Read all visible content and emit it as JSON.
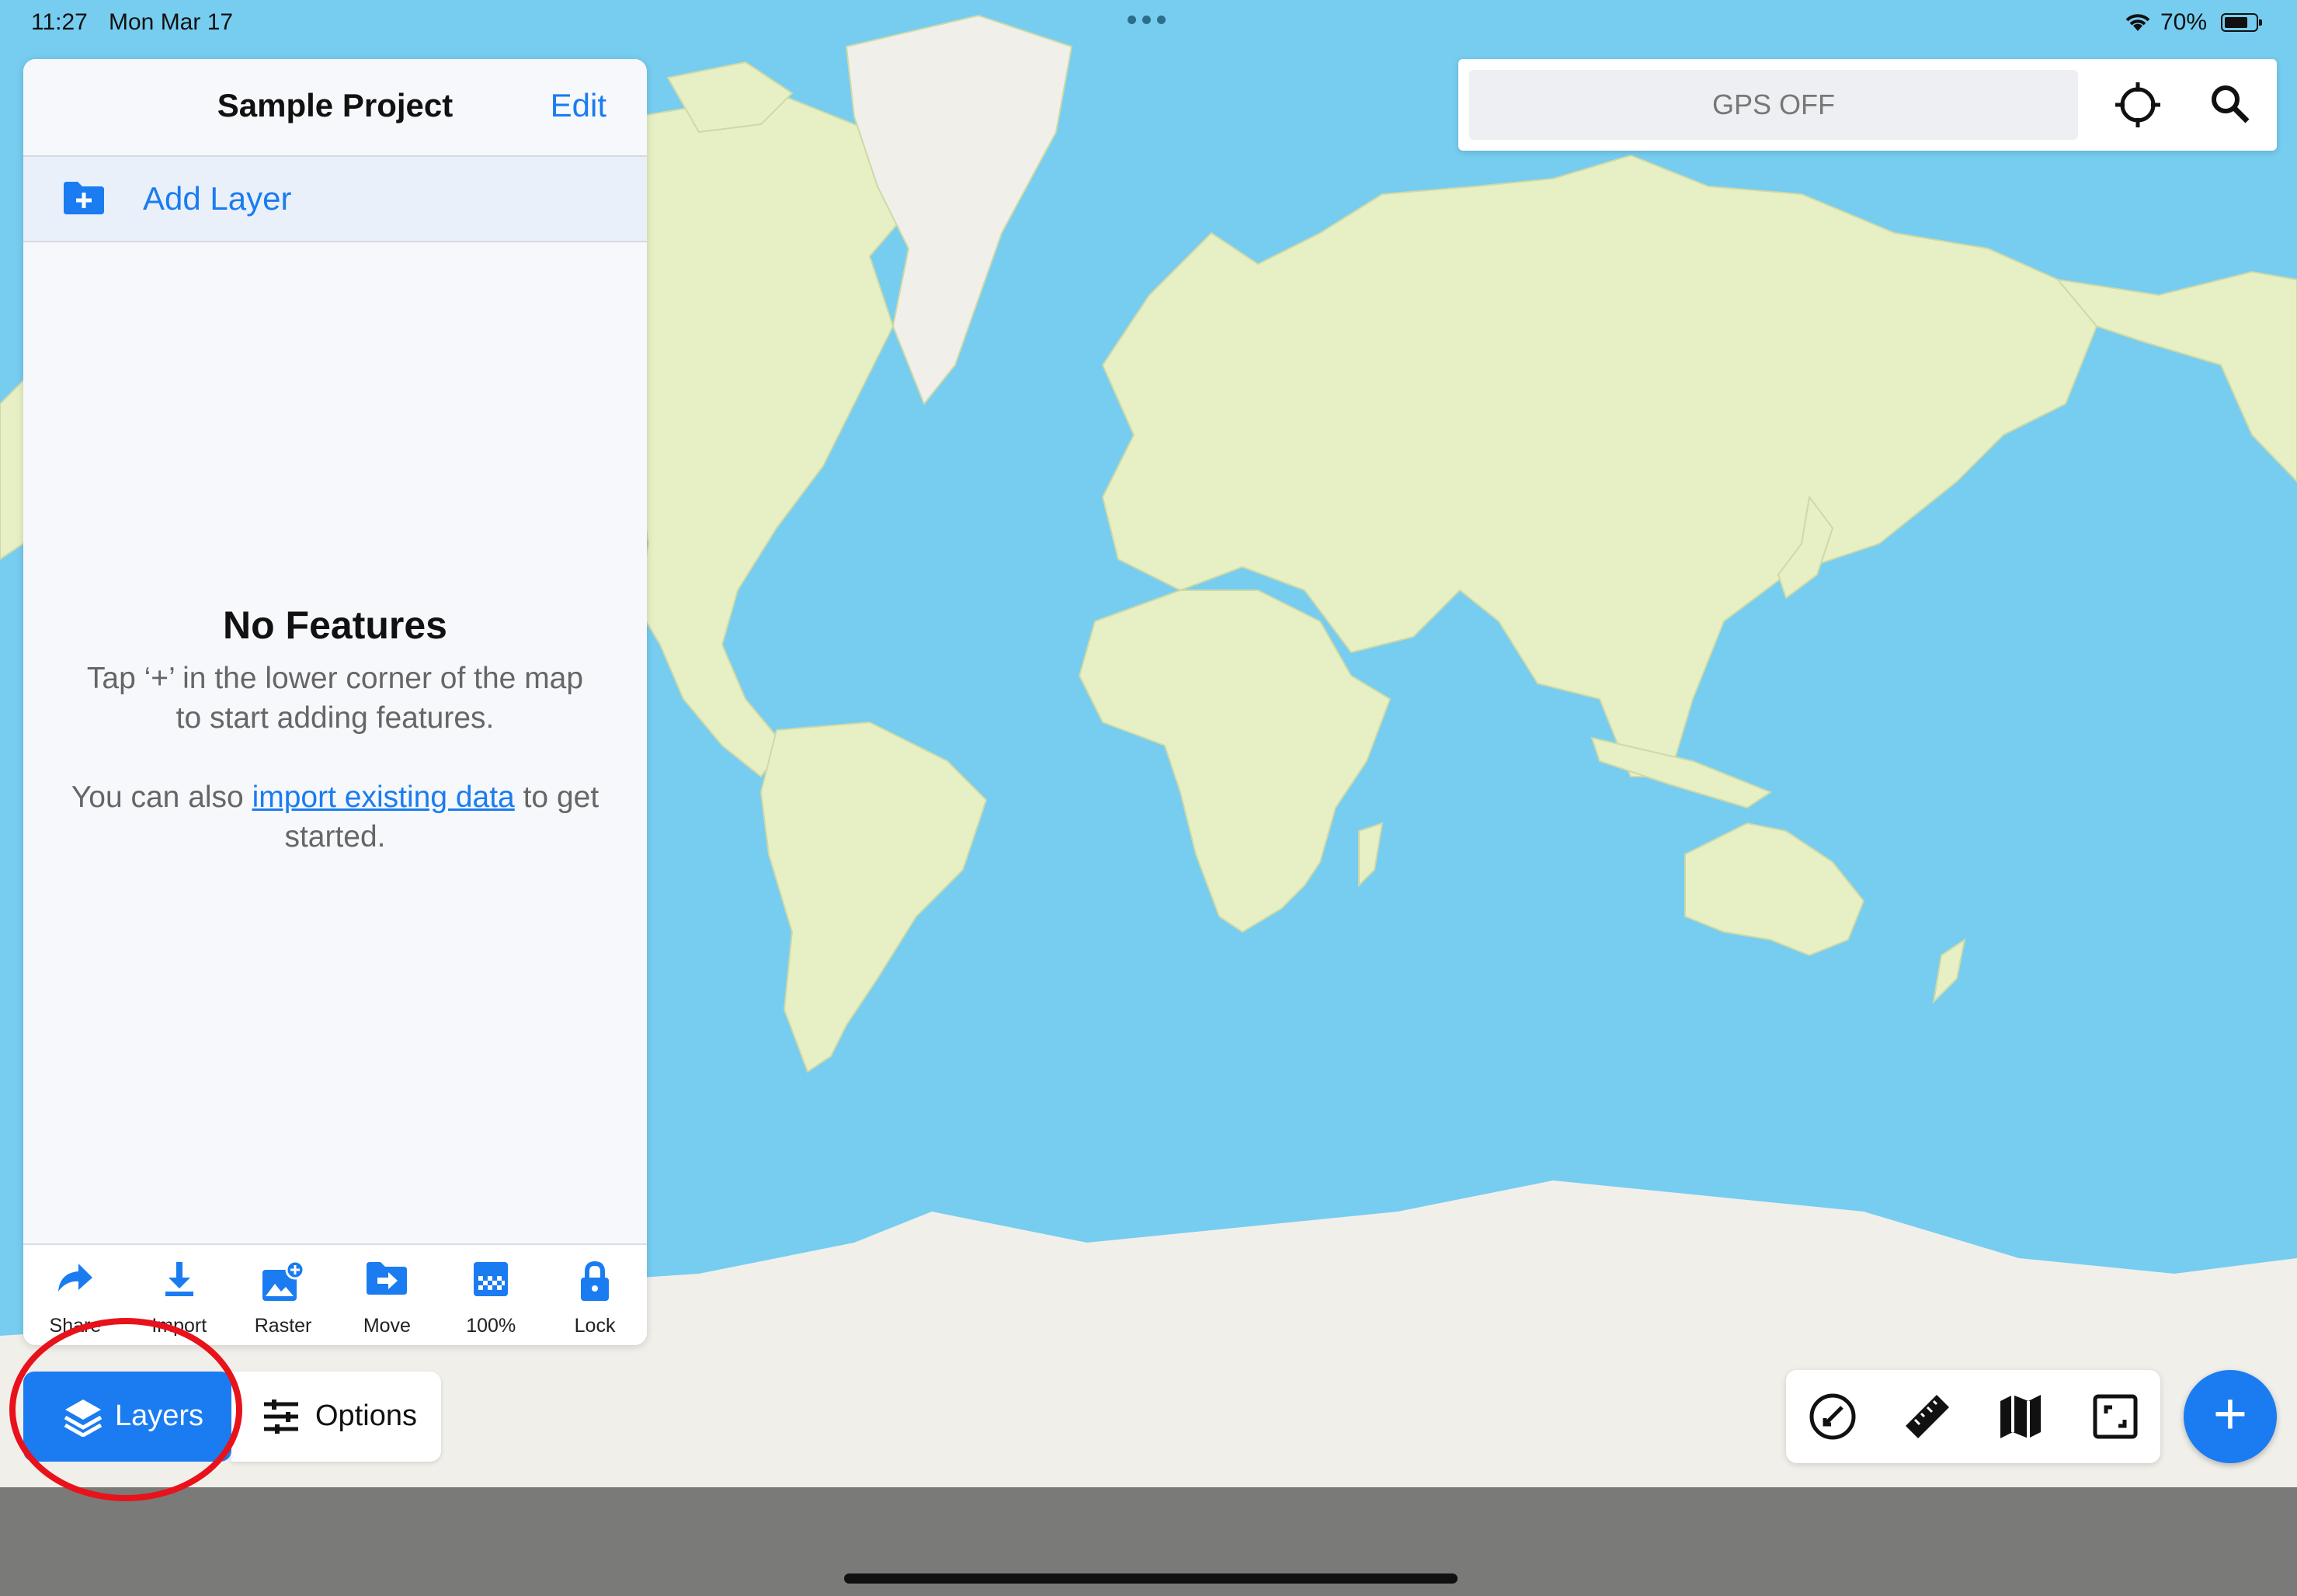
{
  "status_bar": {
    "time": "11:27",
    "date": "Mon Mar 17",
    "battery": "70%"
  },
  "panel": {
    "title": "Sample Project",
    "edit_label": "Edit",
    "add_layer_label": "Add Layer",
    "empty_title": "No Features",
    "empty_text": "Tap ‘+’ in the lower corner of the map to start adding features.",
    "import_prefix": "You can also ",
    "import_link": "import existing data",
    "import_suffix": " to get started."
  },
  "toolbar": [
    {
      "label": "Share",
      "icon": "share-icon"
    },
    {
      "label": "Import",
      "icon": "download-icon"
    },
    {
      "label": "Raster",
      "icon": "raster-add-icon"
    },
    {
      "label": "Move",
      "icon": "folder-move-icon"
    },
    {
      "label": "100%",
      "icon": "opacity-icon"
    },
    {
      "label": "Lock",
      "icon": "lock-icon"
    }
  ],
  "bottom_buttons": {
    "layers_label": "Layers",
    "options_label": "Options"
  },
  "gps": {
    "status": "GPS OFF"
  },
  "map_tools": [
    "compass-icon",
    "ruler-icon",
    "map-icon",
    "extent-icon"
  ],
  "colors": {
    "accent": "#1a7cf0",
    "ocean": "#76cdf0",
    "land": "#e6f0c4",
    "ice": "#f1efea",
    "annotation": "#e8121b"
  }
}
